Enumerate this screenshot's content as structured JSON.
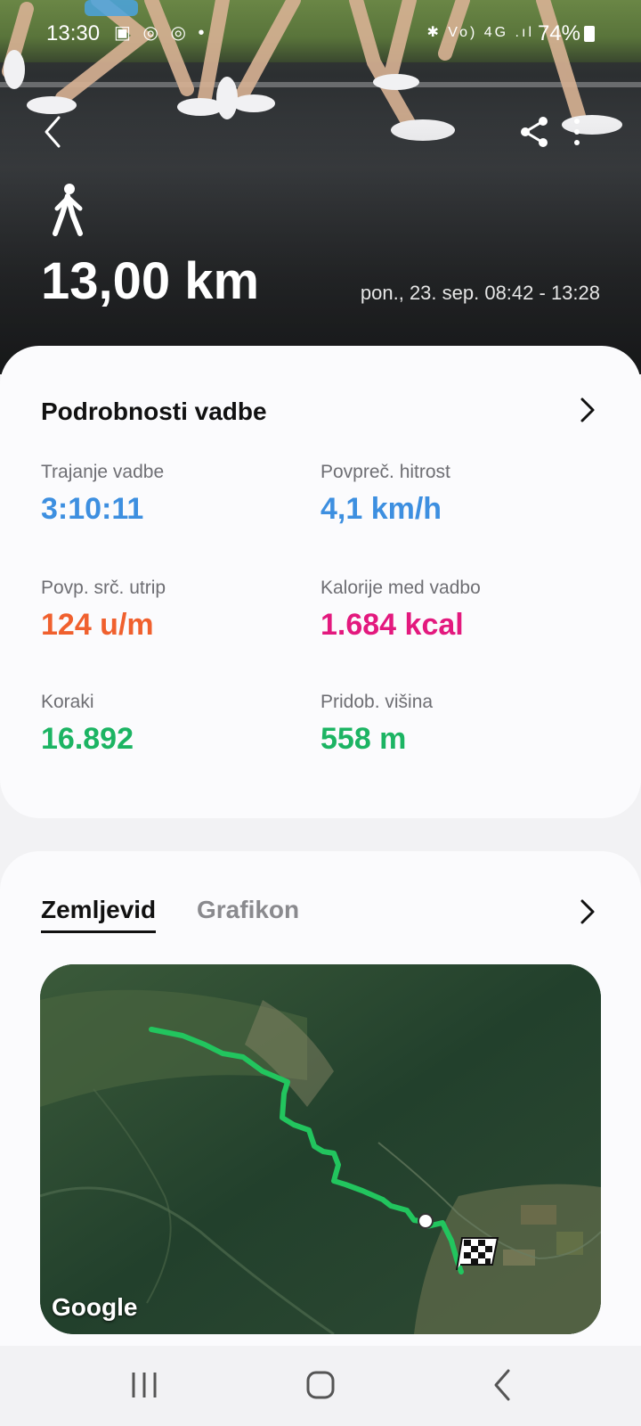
{
  "status_bar": {
    "time": "13:30",
    "left_icons": "▣ ◎ ◎ •",
    "right_icons": "✱ Vo) 4G .ıl",
    "battery": "74%"
  },
  "header": {
    "activity_icon": "walk-icon",
    "distance": "13,00 km",
    "date_range": "pon., 23. sep. 08:42 - 13:28"
  },
  "details": {
    "title": "Podrobnosti vadbe",
    "stats": [
      {
        "label": "Trajanje vadbe",
        "value": "3:10:11",
        "color": "#3d8fe0"
      },
      {
        "label": "Povpreč. hitrost",
        "value": "4,1 km/h",
        "color": "#3d8fe0"
      },
      {
        "label": "Povp. srč. utrip",
        "value": "124 u/m",
        "color": "#f0602e"
      },
      {
        "label": "Kalorije med vadbo",
        "value": "1.684 kcal",
        "color": "#e3197e"
      },
      {
        "label": "Koraki",
        "value": "16.892",
        "color": "#1cb463"
      },
      {
        "label": "Pridob. višina",
        "value": "558 m",
        "color": "#1cb463"
      }
    ]
  },
  "map_section": {
    "tabs": [
      "Zemljevid",
      "Grafikon"
    ],
    "active_tab": "Zemljevid",
    "map_attribution": "Google",
    "route_color": "#22c55e"
  },
  "icons": {
    "back": "chevron-left-icon",
    "share": "share-icon",
    "more": "more-vertical-icon",
    "details_more": "chevron-right-icon",
    "map_more": "chevron-right-icon",
    "finish": "checkered-flag-icon"
  },
  "navbar": {
    "buttons": [
      "recent-apps",
      "home",
      "back"
    ]
  }
}
